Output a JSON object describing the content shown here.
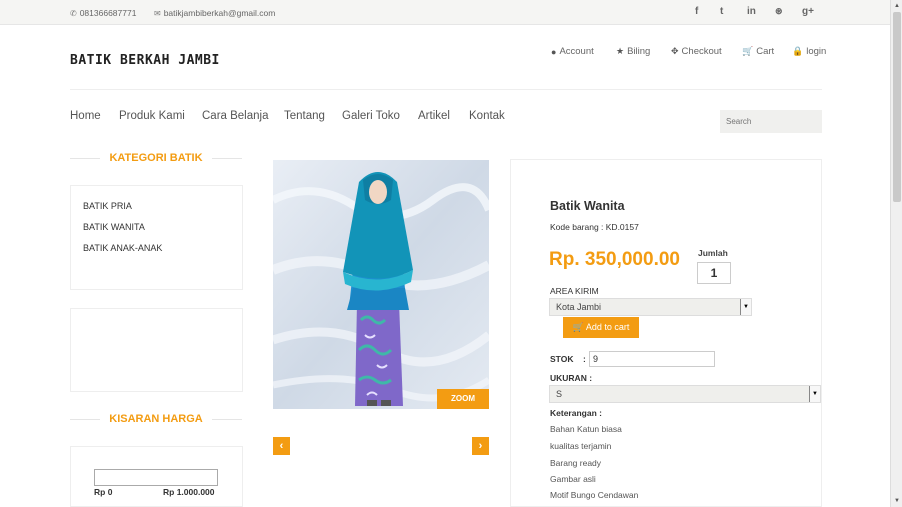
{
  "topbar": {
    "phone": "081366687771",
    "email": "batikjambiberkah@gmail.com",
    "social": [
      "f",
      "t",
      "in",
      "dribbble",
      "g+"
    ]
  },
  "brand": "BATIK BERKAH JAMBI",
  "util_links": [
    "Account",
    "Biling",
    "Checkout",
    "Cart",
    "login"
  ],
  "nav": [
    "Home",
    "Produk Kami",
    "Cara Belanja",
    "Tentang",
    "Galeri Toko",
    "Artikel",
    "Kontak"
  ],
  "search": {
    "placeholder": "Search"
  },
  "sidebar": {
    "kategori_title": "KATEGORI BATIK",
    "categories": [
      "BATIK PRIA",
      "BATIK WANITA",
      "BATIK ANAK-ANAK"
    ],
    "harga_title": "KISARAN HARGA",
    "price_min": "Rp 0",
    "price_max": "Rp 1.000.000"
  },
  "gallery": {
    "zoom_label": "ZOOM",
    "prev": "‹",
    "next": "›"
  },
  "product": {
    "title": "Batik Wanita",
    "code": "Kode barang : KD.0157",
    "price": "Rp. 350,000.00",
    "qty_label": "Jumlah",
    "qty_value": "1",
    "area_label": "AREA KIRIM",
    "area_value": "Kota Jambi",
    "add_to_cart": "Add to cart",
    "stok_label": "STOK",
    "stok_colon": ":",
    "stok_value": "9",
    "ukuran_label": "UKURAN :",
    "ukuran_value": "S",
    "keterangan_label": "Keterangan :",
    "keterangan": [
      "Bahan Katun biasa",
      "kualitas terjamin",
      "Barang ready",
      "Gambar asli",
      "Motif Bungo Cendawan"
    ]
  },
  "colors": {
    "accent": "#f39c12",
    "topbar": "#f5f5f3"
  }
}
